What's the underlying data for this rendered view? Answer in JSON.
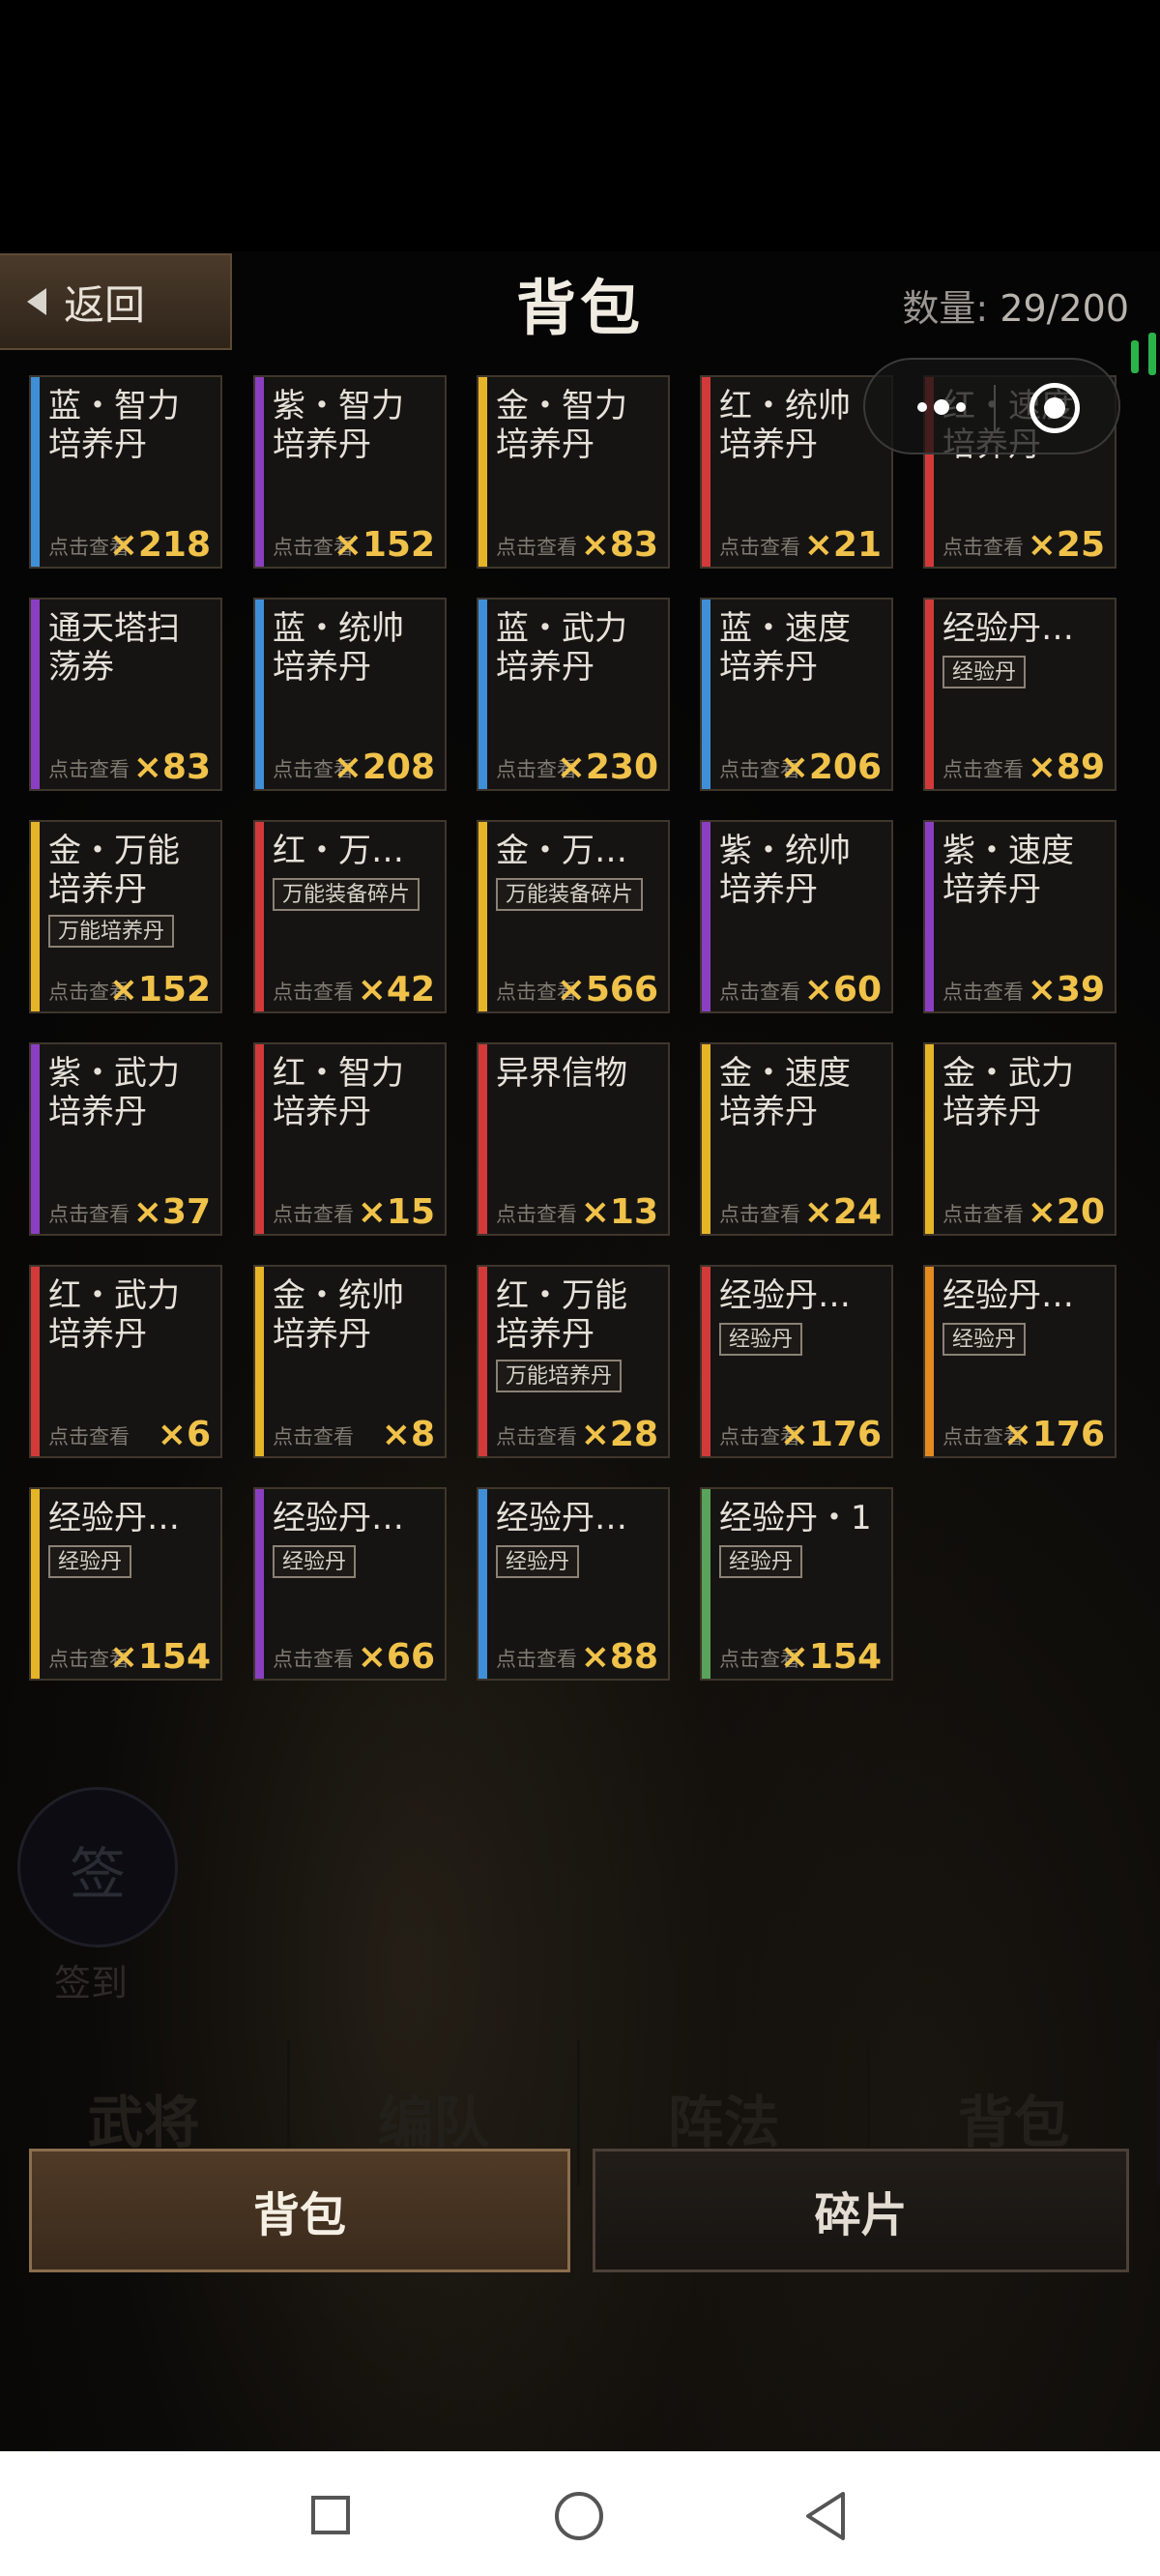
{
  "header": {
    "back_label": "返回",
    "title": "背包",
    "count_label": "数量:",
    "count_value": "29/200"
  },
  "hint_text": "点击查看",
  "items": [
    {
      "name": "蓝・智力\n培养丹",
      "color": "#3f8fd8",
      "qty": "×218"
    },
    {
      "name": "紫・智力\n培养丹",
      "color": "#8a3fc2",
      "qty": "×152"
    },
    {
      "name": "金・智力\n培养丹",
      "color": "#e6b527",
      "qty": "×83"
    },
    {
      "name": "红・统帅\n培养丹",
      "color": "#d23a3a",
      "qty": "×21"
    },
    {
      "name": "红・速度\n培养丹",
      "color": "#d23a3a",
      "qty": "×25"
    },
    {
      "name": "通天塔扫\n荡券",
      "color": "#8a3fc2",
      "qty": "×83"
    },
    {
      "name": "蓝・统帅\n培养丹",
      "color": "#3f8fd8",
      "qty": "×208"
    },
    {
      "name": "蓝・武力\n培养丹",
      "color": "#3f8fd8",
      "qty": "×230"
    },
    {
      "name": "蓝・速度\n培养丹",
      "color": "#3f8fd8",
      "qty": "×206"
    },
    {
      "name": "经验丹…",
      "color": "#d23a3a",
      "qty": "×89",
      "tag": "经验丹"
    },
    {
      "name": "金・万能\n培养丹",
      "color": "#e6b527",
      "qty": "×152",
      "tag": "万能培养丹"
    },
    {
      "name": "红・万…",
      "color": "#d23a3a",
      "qty": "×42",
      "tag": "万能装备碎片"
    },
    {
      "name": "金・万…",
      "color": "#e6b527",
      "qty": "×566",
      "tag": "万能装备碎片"
    },
    {
      "name": "紫・统帅\n培养丹",
      "color": "#8a3fc2",
      "qty": "×60"
    },
    {
      "name": "紫・速度\n培养丹",
      "color": "#8a3fc2",
      "qty": "×39"
    },
    {
      "name": "紫・武力\n培养丹",
      "color": "#8a3fc2",
      "qty": "×37"
    },
    {
      "name": "红・智力\n培养丹",
      "color": "#d23a3a",
      "qty": "×15"
    },
    {
      "name": "异界信物",
      "color": "#d23a3a",
      "qty": "×13"
    },
    {
      "name": "金・速度\n培养丹",
      "color": "#e6b527",
      "qty": "×24"
    },
    {
      "name": "金・武力\n培养丹",
      "color": "#e6b527",
      "qty": "×20"
    },
    {
      "name": "红・武力\n培养丹",
      "color": "#d23a3a",
      "qty": "×6"
    },
    {
      "name": "金・统帅\n培养丹",
      "color": "#e6b527",
      "qty": "×8"
    },
    {
      "name": "红・万能\n培养丹",
      "color": "#d23a3a",
      "qty": "×28",
      "tag": "万能培养丹"
    },
    {
      "name": "经验丹…",
      "color": "#d23a3a",
      "qty": "×176",
      "tag": "经验丹"
    },
    {
      "name": "经验丹…",
      "color": "#e38a21",
      "qty": "×176",
      "tag": "经验丹"
    },
    {
      "name": "经验丹…",
      "color": "#e6b527",
      "qty": "×154",
      "tag": "经验丹"
    },
    {
      "name": "经验丹…",
      "color": "#8a3fc2",
      "qty": "×66",
      "tag": "经验丹"
    },
    {
      "name": "经验丹…",
      "color": "#3f8fd8",
      "qty": "×88",
      "tag": "经验丹"
    },
    {
      "name": "经验丹・1",
      "color": "#59a35a",
      "qty": "×154",
      "tag": "经验丹"
    }
  ],
  "background": {
    "sign_glyph": "签",
    "sign_label": "签到",
    "tabs": [
      "武将",
      "编队",
      "阵法",
      "背包"
    ]
  },
  "tabs": {
    "bag": "背包",
    "fragments": "碎片"
  }
}
